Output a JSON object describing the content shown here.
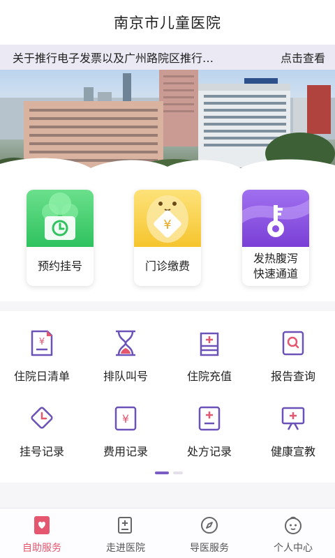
{
  "header": {
    "title": "南京市儿童医院"
  },
  "notice": {
    "text": "关于推行电子发票以及广州路院区推行…",
    "more_label": "点击查看"
  },
  "feature_cards": [
    {
      "label": "预约挂号",
      "icon": "clock-icon",
      "color": "#3fcf6a"
    },
    {
      "label": "门诊缴费",
      "icon": "yen-icon",
      "color": "#f6c93b"
    },
    {
      "label": "发热腹泻\n快速通道",
      "icon": "key-icon",
      "color": "#8a52e0"
    }
  ],
  "services": [
    {
      "label": "住院日清单",
      "icon": "bill-icon"
    },
    {
      "label": "排队叫号",
      "icon": "hourglass-icon"
    },
    {
      "label": "住院充值",
      "icon": "bed-plus-icon"
    },
    {
      "label": "报告查询",
      "icon": "report-search-icon"
    },
    {
      "label": "挂号记录",
      "icon": "clock-diamond-icon"
    },
    {
      "label": "费用记录",
      "icon": "yen-record-icon"
    },
    {
      "label": "处方记录",
      "icon": "prescription-icon"
    },
    {
      "label": "健康宣教",
      "icon": "presentation-icon"
    }
  ],
  "pager": {
    "current": 1,
    "total": 2
  },
  "tabbar": [
    {
      "label": "自助服务",
      "icon": "self-service-icon",
      "active": true
    },
    {
      "label": "走进医院",
      "icon": "hospital-info-icon",
      "active": false
    },
    {
      "label": "导医服务",
      "icon": "compass-icon",
      "active": false
    },
    {
      "label": "个人中心",
      "icon": "baby-face-icon",
      "active": false
    }
  ],
  "colors": {
    "accent": "#e4576e",
    "purple": "#6b52b8",
    "pink": "#e4576e"
  }
}
